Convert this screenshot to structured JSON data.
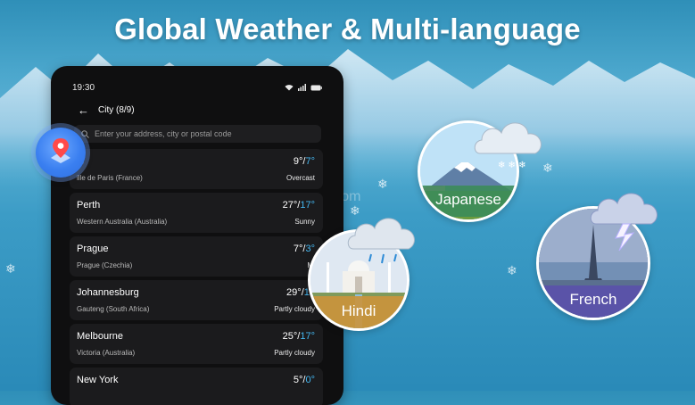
{
  "headline": "Global Weather & Multi-language",
  "watermark": "teStar.com",
  "phone": {
    "status_time": "19:30",
    "app_title": "City (8/9)",
    "search_placeholder": "Enter your address, city or postal code",
    "cities": [
      {
        "name": "is",
        "region": "ille de Paris (France)",
        "high": "9°",
        "low": "7°",
        "condition": "Overcast"
      },
      {
        "name": "Perth",
        "region": "Western Australia (Australia)",
        "high": "27°",
        "low": "17°",
        "condition": "Sunny"
      },
      {
        "name": "Prague",
        "region": "Prague (Czechia)",
        "high": "7°",
        "low": "3°",
        "condition": "Mi"
      },
      {
        "name": "Johannesburg",
        "region": "Gauteng (South Africa)",
        "high": "29°",
        "low": "15",
        "condition": "Partly cloudy"
      },
      {
        "name": "Melbourne",
        "region": "Victoria (Australia)",
        "high": "25°",
        "low": "17°",
        "condition": "Partly cloudy"
      },
      {
        "name": "New York",
        "region": "",
        "high": "5°",
        "low": "0°",
        "condition": ""
      }
    ]
  },
  "languages": {
    "japanese": "Japanese",
    "hindi": "Hindi",
    "french": "French"
  },
  "icons": [
    "map-pin-icon",
    "back-arrow-icon",
    "search-icon",
    "wifi-icon",
    "signal-icon",
    "battery-icon",
    "cloud-snow-icon",
    "cloud-rain-icon",
    "cloud-storm-icon",
    "snowflake-icon"
  ],
  "colors": {
    "accent_low_temp": "#44b6f0",
    "card_bg": "#1b1b1d",
    "phone_bg": "#0f0f10",
    "pin_bubble": "#3a7ff0"
  }
}
